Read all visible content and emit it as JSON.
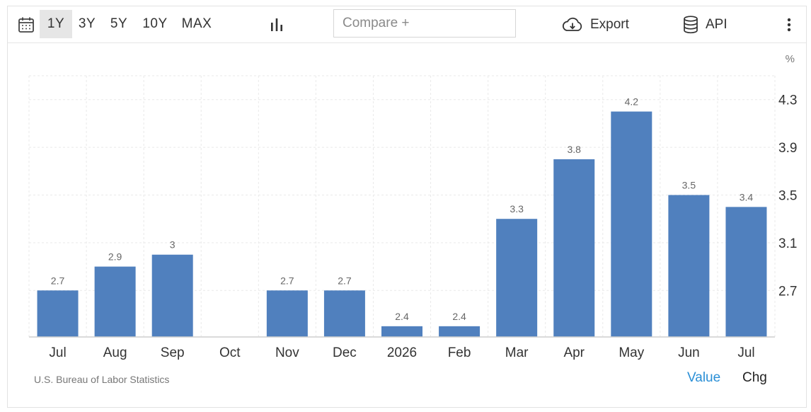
{
  "toolbar": {
    "ranges": [
      "1Y",
      "3Y",
      "5Y",
      "10Y",
      "MAX"
    ],
    "active_range": "1Y",
    "compare_placeholder": "Compare +",
    "export_label": "Export",
    "api_label": "API"
  },
  "footer": {
    "source": "U.S. Bureau of Labor Statistics",
    "value_label": "Value",
    "chg_label": "Chg"
  },
  "colors": {
    "bar": "#5080be",
    "active_toggle": "#2a8fd6",
    "grid": "#e9e9e9"
  },
  "chart_data": {
    "type": "bar",
    "categories": [
      "Jul",
      "Aug",
      "Sep",
      "Oct",
      "Nov",
      "Dec",
      "2026",
      "Feb",
      "Mar",
      "Apr",
      "May",
      "Jun",
      "Jul"
    ],
    "values": [
      2.7,
      2.9,
      3,
      null,
      2.7,
      2.7,
      2.4,
      2.4,
      3.3,
      3.8,
      4.2,
      3.5,
      3.4
    ],
    "data_labels": [
      "2.7",
      "2.9",
      "3",
      "",
      "2.7",
      "2.7",
      "2.4",
      "2.4",
      "3.3",
      "3.8",
      "4.2",
      "3.5",
      "3.4"
    ],
    "y_ticks": [
      2.7,
      3.1,
      3.5,
      3.9,
      4.3
    ],
    "y_tick_labels": [
      "2.7",
      "3.1",
      "3.5",
      "3.9",
      "4.3"
    ],
    "ylabel": "%",
    "ylim": [
      2.31,
      4.5
    ],
    "y_axis_side": "right",
    "grid": true
  }
}
